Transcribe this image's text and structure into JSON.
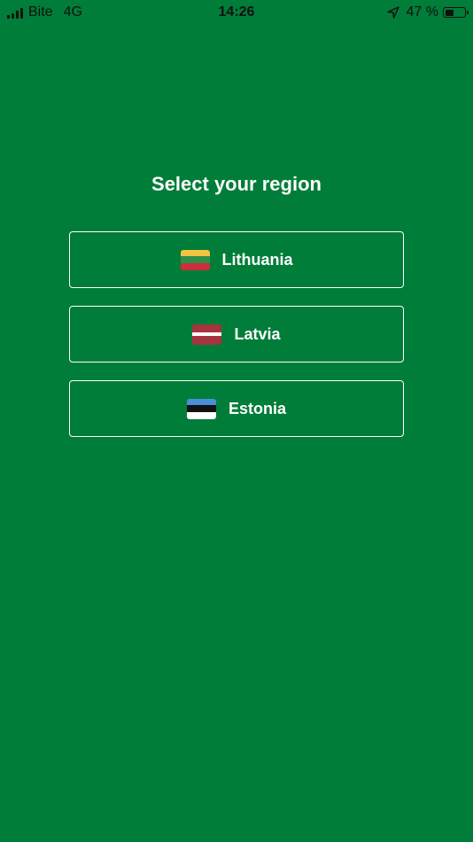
{
  "status_bar": {
    "carrier": "Bite",
    "network": "4G",
    "time": "14:26",
    "battery_percent": "47 %",
    "battery_level": 0.47,
    "icons": [
      "signal-icon",
      "location-arrow-icon",
      "battery-icon"
    ]
  },
  "screen": {
    "title": "Select your region",
    "background_color": "#007d38"
  },
  "regions": [
    {
      "label": "Lithuania",
      "flag": "lithuania-flag-icon",
      "flag_colors": [
        "#f3c443",
        "#2f8f48",
        "#cc2f3c"
      ]
    },
    {
      "label": "Latvia",
      "flag": "latvia-flag-icon",
      "flag_colors": [
        "#a6333d",
        "#ffffff",
        "#a6333d"
      ]
    },
    {
      "label": "Estonia",
      "flag": "estonia-flag-icon",
      "flag_colors": [
        "#4d8fd6",
        "#111111",
        "#ffffff"
      ]
    }
  ]
}
